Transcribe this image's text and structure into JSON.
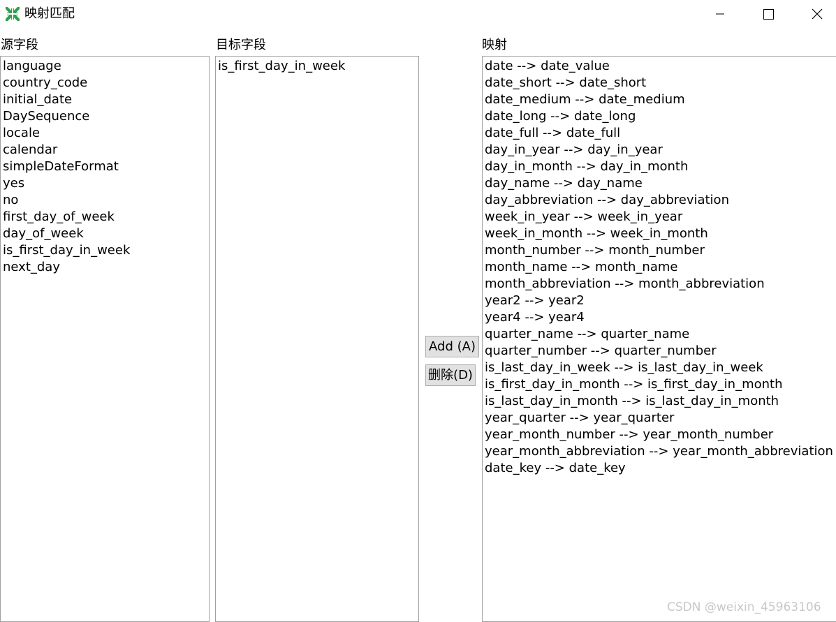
{
  "window": {
    "title": "映射匹配",
    "icon": "collapse-arrows-icon",
    "controls": {
      "minimize": "minimize-icon",
      "maximize": "maximize-icon",
      "close": "close-icon"
    }
  },
  "source": {
    "label": "源字段",
    "items": [
      "language",
      "country_code",
      "initial_date",
      "DaySequence",
      "locale",
      "calendar",
      "simpleDateFormat",
      "yes",
      "no",
      "first_day_of_week",
      "day_of_week",
      "is_first_day_in_week",
      "next_day"
    ]
  },
  "target": {
    "label": "目标字段",
    "items": [
      "is_first_day_in_week"
    ]
  },
  "buttons": {
    "add": "Add (A)",
    "delete": "删除(D)"
  },
  "mapping": {
    "label": "映射",
    "items": [
      "date --> date_value",
      "date_short --> date_short",
      "date_medium --> date_medium",
      "date_long --> date_long",
      "date_full --> date_full",
      "day_in_year --> day_in_year",
      "day_in_month --> day_in_month",
      "day_name --> day_name",
      "day_abbreviation --> day_abbreviation",
      "week_in_year --> week_in_year",
      "week_in_month --> week_in_month",
      "month_number --> month_number",
      "month_name --> month_name",
      "month_abbreviation --> month_abbreviation",
      "year2 --> year2",
      "year4 --> year4",
      "quarter_name --> quarter_name",
      "quarter_number --> quarter_number",
      "is_last_day_in_week --> is_last_day_in_week",
      "is_first_day_in_month --> is_first_day_in_month",
      "is_last_day_in_month --> is_last_day_in_month",
      "year_quarter --> year_quarter",
      "year_month_number --> year_month_number",
      "year_month_abbreviation --> year_month_abbreviation",
      "date_key --> date_key"
    ]
  },
  "watermark": "CSDN @weixin_45963106",
  "colors": {
    "icon_green": "#2e9e4f",
    "list_border": "#a0a0a0",
    "button_bg": "#e1e1e1",
    "button_border": "#adadad"
  }
}
